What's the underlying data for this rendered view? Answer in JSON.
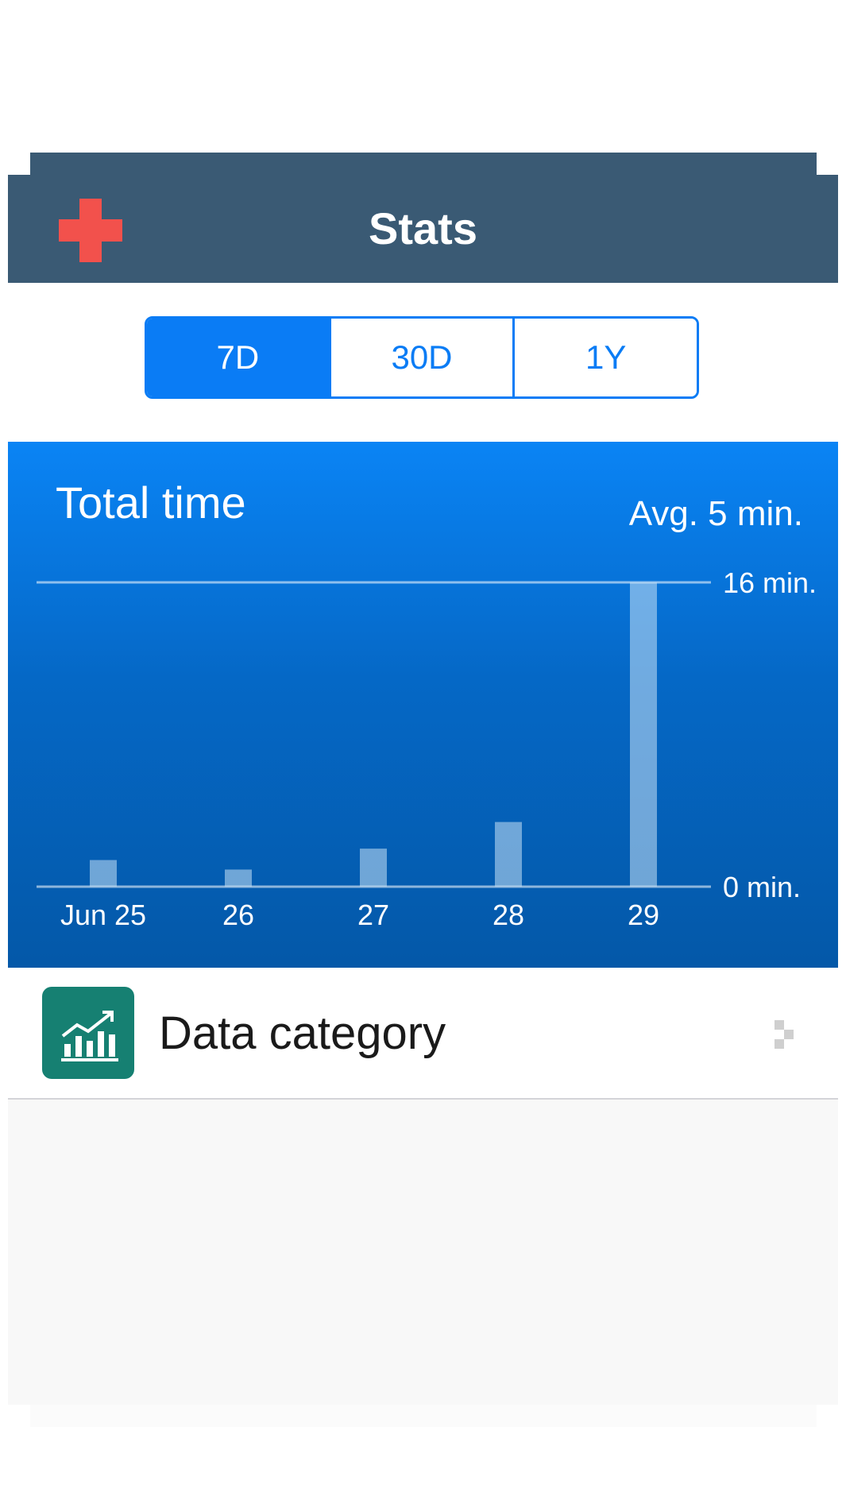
{
  "nav": {
    "title": "Stats",
    "left_icon": "medical-cross-icon",
    "left_icon_color": "#f2514c",
    "bar_color": "#3a5a74"
  },
  "range": {
    "options": [
      "7D",
      "30D",
      "1Y"
    ],
    "selected": "7D",
    "accent": "#0a7cf5"
  },
  "summary": {
    "title": "Total time",
    "average": "Avg. 5 min."
  },
  "chart_data": {
    "type": "bar",
    "categories": [
      "Jun 25",
      "26",
      "27",
      "28",
      "29"
    ],
    "values": [
      1.4,
      0.9,
      2,
      3.4,
      16
    ],
    "ylim": [
      0,
      16
    ],
    "y_tick_labels": [
      "16 min.",
      "0 min."
    ],
    "grid": true
  },
  "list": {
    "items": [
      {
        "label": "Data category",
        "icon": "chart-icon",
        "icon_color": "#168072",
        "accessory": "chevron-right-icon"
      }
    ]
  }
}
